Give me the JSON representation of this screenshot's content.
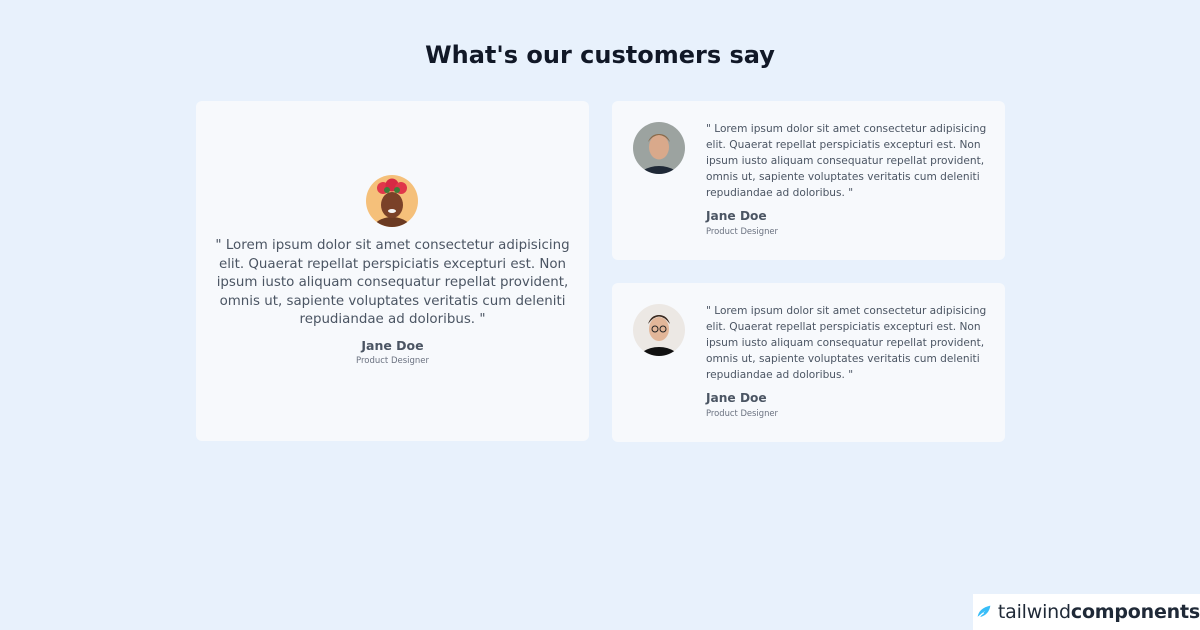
{
  "page": {
    "title": "What's our customers say",
    "background": "#e8f1fc"
  },
  "testimonials": [
    {
      "quote": "\" Lorem ipsum dolor sit amet consectetur adipisicing elit. Quaerat repellat perspiciatis excepturi est. Non ipsum iusto aliquam consequatur repellat provident, omnis ut, sapiente voluptates veritatis cum deleniti repudiandae ad doloribus. \"",
      "name": "Jane Doe",
      "role": "Product Designer",
      "avatar": "woman-flower-crown-avatar"
    },
    {
      "quote": "\" Lorem ipsum dolor sit amet consectetur adipisicing elit. Quaerat repellat perspiciatis excepturi est. Non ipsum iusto aliquam consequatur repellat provident, omnis ut, sapiente voluptates veritatis cum deleniti repudiandae ad doloribus. \"",
      "name": "Jane Doe",
      "role": "Product Designer",
      "avatar": "man-portrait-avatar"
    },
    {
      "quote": "\" Lorem ipsum dolor sit amet consectetur adipisicing elit. Quaerat repellat perspiciatis excepturi est. Non ipsum iusto aliquam consequatur repellat provident, omnis ut, sapiente voluptates veritatis cum deleniti repudiandae ad doloribus. \"",
      "name": "Jane Doe",
      "role": "Product Designer",
      "avatar": "man-glasses-avatar"
    }
  ],
  "brand": {
    "part1": "tailwind",
    "part2": "components",
    "icon": "tailwind-leaf-icon",
    "accent": "#38bdf8"
  }
}
